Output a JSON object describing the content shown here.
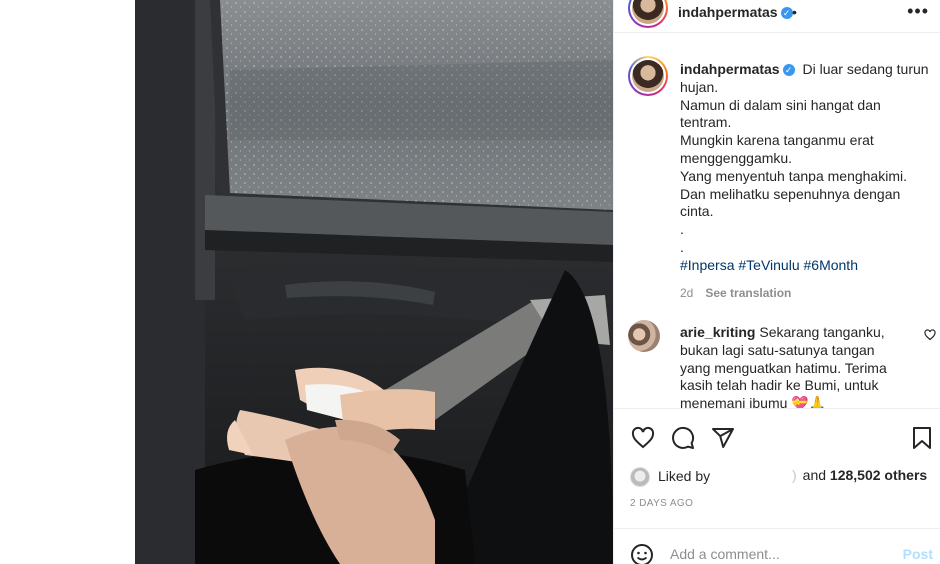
{
  "post": {
    "username": "indahpermatas",
    "verified": true,
    "header_separator": "•",
    "more_icon": "more-horizontal-icon"
  },
  "caption": {
    "username": "indahpermatas",
    "lines": [
      "Di luar sedang turun hujan.",
      "Namun di dalam sini hangat dan tentram.",
      "Mungkin karena tanganmu erat menggenggamku.",
      "Yang menyentuh tanpa menghakimi.",
      "Dan melihatku sepenuhnya dengan cinta.",
      ".",
      "."
    ],
    "hashtags": "#Inpersa #TeVinulu #6Month",
    "age": "2d",
    "see_translation": "See translation"
  },
  "comments": [
    {
      "username": "arie_kriting",
      "text": "Sekarang tanganku, bukan lagi satu-satunya tangan yang menguatkan hatimu. Terima kasih telah hadir ke Bumi, untuk menemani ibumu 💝🙏"
    }
  ],
  "likes": {
    "prefix": "Liked by",
    "fragment": ")",
    "and": "and",
    "count": "128,502 others"
  },
  "timestamp": "2 DAYS AGO",
  "add_comment": {
    "placeholder": "Add a comment...",
    "post_label": "Post"
  },
  "colors": {
    "link_blue": "#00376b",
    "verified_blue": "#3897f0",
    "post_disabled": "#b2dffc",
    "secondary_text": "#8e8e8e"
  }
}
